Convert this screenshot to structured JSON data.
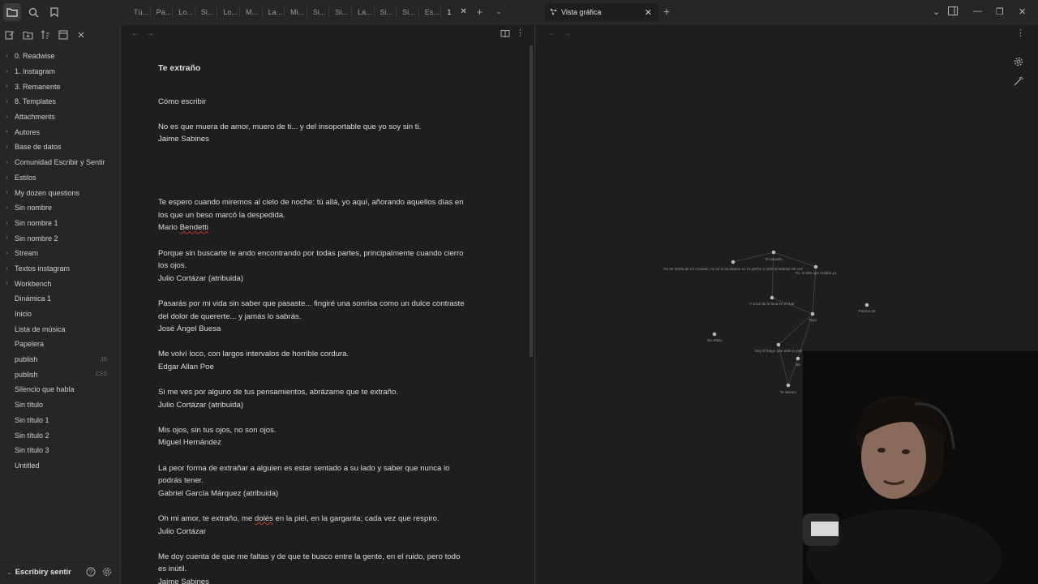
{
  "sidebar": {
    "items": [
      {
        "label": "0. Readwise",
        "folder": true,
        "ext": ""
      },
      {
        "label": "1. Instagram",
        "folder": true,
        "ext": ""
      },
      {
        "label": "3. Remanente",
        "folder": true,
        "ext": ""
      },
      {
        "label": "8. Templates",
        "folder": true,
        "ext": ""
      },
      {
        "label": "Attachments",
        "folder": true,
        "ext": ""
      },
      {
        "label": "Autores",
        "folder": true,
        "ext": ""
      },
      {
        "label": "Base de datos",
        "folder": true,
        "ext": ""
      },
      {
        "label": "Comunidad Escribir y Sentir",
        "folder": true,
        "ext": ""
      },
      {
        "label": "Estilos",
        "folder": true,
        "ext": ""
      },
      {
        "label": "My dozen questions",
        "folder": true,
        "ext": ""
      },
      {
        "label": "Sin nombre",
        "folder": true,
        "ext": ""
      },
      {
        "label": "Sin nombre 1",
        "folder": true,
        "ext": ""
      },
      {
        "label": "Sin nombre 2",
        "folder": true,
        "ext": ""
      },
      {
        "label": "Stream",
        "folder": true,
        "ext": ""
      },
      {
        "label": "Textos instagram",
        "folder": true,
        "ext": ""
      },
      {
        "label": "Workbench",
        "folder": true,
        "ext": ""
      },
      {
        "label": "Dinámica 1",
        "folder": false,
        "ext": ""
      },
      {
        "label": "Inicio",
        "folder": false,
        "ext": ""
      },
      {
        "label": "Lista de música",
        "folder": false,
        "ext": ""
      },
      {
        "label": "Papelera",
        "folder": false,
        "ext": ""
      },
      {
        "label": "publish",
        "folder": false,
        "ext": "JS"
      },
      {
        "label": "publish",
        "folder": false,
        "ext": "CSS"
      },
      {
        "label": "Silencio que habla",
        "folder": false,
        "ext": ""
      },
      {
        "label": "Sin título",
        "folder": false,
        "ext": ""
      },
      {
        "label": "Sin título 1",
        "folder": false,
        "ext": ""
      },
      {
        "label": "Sin título 2",
        "folder": false,
        "ext": ""
      },
      {
        "label": "Sin título 3",
        "folder": false,
        "ext": ""
      },
      {
        "label": "Untitled",
        "folder": false,
        "ext": ""
      }
    ],
    "vault_name": "Escribiry sentir"
  },
  "tabs": {
    "left": [
      "Tú...",
      "Pa...",
      "Lo...",
      "Si...",
      "Lo...",
      "M...",
      "La...",
      "Mi...",
      "Si...",
      "Si...",
      "La...",
      "Si...",
      "Si...",
      "Es..."
    ],
    "active_left": "1",
    "right_title": "Vista gráfica"
  },
  "note": {
    "title": "Te extraño",
    "paragraphs": [
      [
        "Cómo escribir"
      ],
      [
        "No es que muera de amor, muero de ti... y del insoportable que yo soy sin ti.",
        "Jaime Sabines"
      ],
      [
        ""
      ],
      [
        "Te espero cuando miremos al cielo de noche: tú allá, yo aquí, añorando aquellos días en",
        "los que un beso marcó la despedida.",
        "Mario Bendetti"
      ],
      [
        "Porque sin buscarte te ando encontrando por todas partes, principalmente cuando cierro",
        "los ojos.",
        "Julio Cortázar (atribuida)"
      ],
      [
        "Pasarás por mi vida sin saber que pasaste... fingiré una sonrisa como un dulce contraste",
        "del dolor de quererte... y jamás lo sabrás.",
        "José Ángel Buesa"
      ],
      [
        "Me volví loco, con largos intervalos de horrible cordura.",
        "Edgar Allan Poe"
      ],
      [
        "Si me ves por alguno de tus pensamientos, abrázame que te extraño.",
        "Julio Cortázar (atribuida)"
      ],
      [
        "Mis ojos, sin tus ojos, no son ojos.",
        "Miguel Hernández"
      ],
      [
        "La peor forma de extrañar a alguien es estar sentado a su lado y saber que nunca lo",
        "podrás tener.",
        "Gabriel García Márquez (atribuida)"
      ],
      [
        "Oh mi amor, te extraño, me dolés en la piel, en la garganta; cada vez que respiro.",
        "Julio Cortázar"
      ],
      [
        "Me doy cuenta de que me faltas y de que te busco entre la gente, en el ruido, pero todo",
        "es inútil.",
        "Jaime Sabines"
      ]
    ]
  },
  "graph": {
    "nodes": [
      {
        "label": "Te extraño"
      },
      {
        "label": "No se moría de mí corazón, no sé si se detuvo en mi pecho o voló al rededor de voz"
      },
      {
        "label": "Tú, el aire que respiro yo"
      },
      {
        "label": "Y a luz de la luna en el mar"
      },
      {
        "label": "Tuyo"
      },
      {
        "label": "Poema 20"
      },
      {
        "label": "Sin título"
      },
      {
        "label": "Soy el fuego que arde tu piel"
      },
      {
        "label": "Sé"
      },
      {
        "label": "Te devoro"
      }
    ]
  },
  "colors": {
    "accent": "#7f6df2",
    "bg": "#1e1e1e",
    "sidebar": "#262626"
  }
}
